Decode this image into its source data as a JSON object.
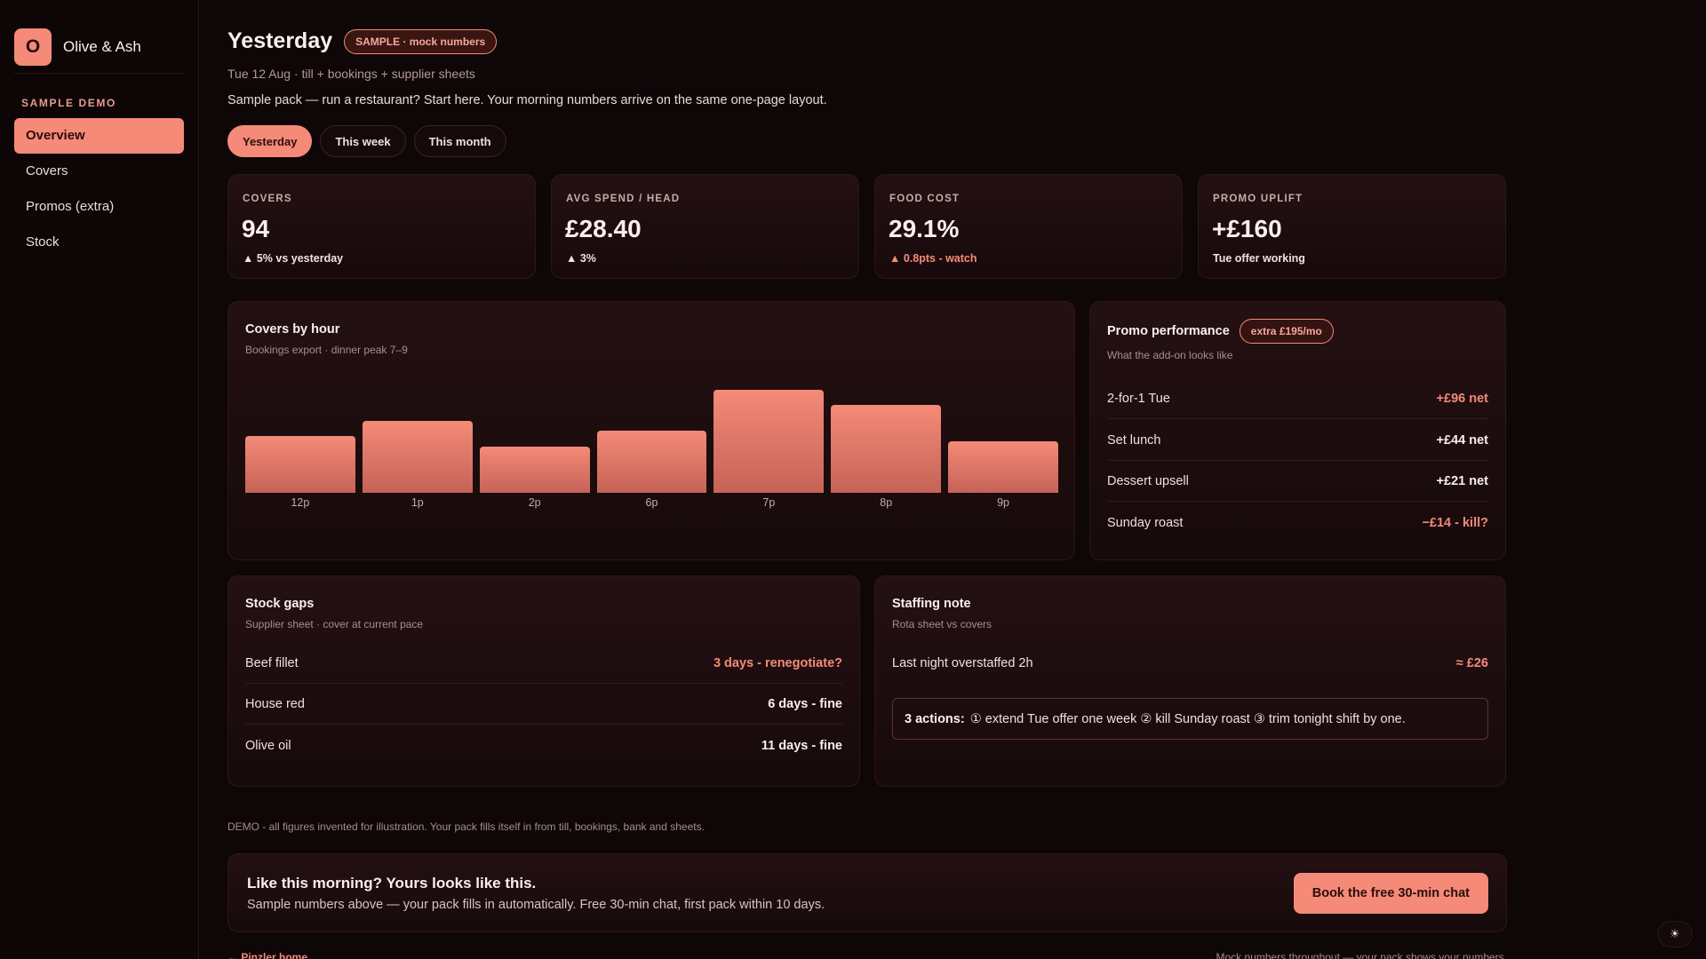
{
  "brand": {
    "logo_letter": "O",
    "name": "Olive & Ash"
  },
  "sidebar": {
    "section": "SAMPLE DEMO",
    "items": [
      {
        "label": "Overview",
        "active": true
      },
      {
        "label": "Covers"
      },
      {
        "label": "Promos (extra)"
      },
      {
        "label": "Stock"
      }
    ]
  },
  "header": {
    "title": "Yesterday",
    "badge": "SAMPLE · mock numbers",
    "subtitle": "Tue 12 Aug · till + bookings + supplier sheets",
    "intro": "Sample pack — run a restaurant? Start here. Your morning numbers arrive on the same one-page layout."
  },
  "tabs": [
    {
      "label": "Yesterday",
      "active": true
    },
    {
      "label": "This week"
    },
    {
      "label": "This month"
    }
  ],
  "kpis": [
    {
      "label": "COVERS",
      "value": "94",
      "delta": "▲ 5% vs yesterday"
    },
    {
      "label": "AVG SPEND / HEAD",
      "value": "£28.40",
      "delta": "▲ 3%"
    },
    {
      "label": "FOOD COST",
      "value": "29.1%",
      "delta": "▲ 0.8pts - watch"
    },
    {
      "label": "PROMO UPLIFT",
      "value": "+£160",
      "delta": "Tue offer working"
    }
  ],
  "covers_chart": {
    "title": "Covers by hour",
    "subtitle": "Bookings export · dinner peak 7–9"
  },
  "chart_data": {
    "type": "bar",
    "categories": [
      "12p",
      "1p",
      "2p",
      "6p",
      "7p",
      "8p",
      "9p"
    ],
    "values": [
      11,
      14,
      9,
      12,
      20,
      17,
      10
    ],
    "ylim": [
      0,
      20
    ],
    "grid": false,
    "color": "#f58a78"
  },
  "promo": {
    "title": "Promo performance",
    "badge": "extra £195/mo",
    "subtitle": "What the add-on looks like",
    "rows": [
      {
        "label": "2-for-1 Tue",
        "value": "+£96 net",
        "accent": true
      },
      {
        "label": "Set lunch",
        "value": "+£44 net",
        "accent": false
      },
      {
        "label": "Dessert upsell",
        "value": "+£21 net",
        "accent": false
      },
      {
        "label": "Sunday roast",
        "value": "−£14 - kill?",
        "accent": true
      }
    ]
  },
  "stock": {
    "title": "Stock gaps",
    "subtitle": "Supplier sheet · cover at current pace",
    "rows": [
      {
        "label": "Beef fillet",
        "value": "3 days - renegotiate?",
        "accent": true
      },
      {
        "label": "House red",
        "value": "6 days - fine",
        "accent": false
      },
      {
        "label": "Olive oil",
        "value": "11 days - fine",
        "accent": false
      }
    ]
  },
  "staffing": {
    "title": "Staffing note",
    "subtitle": "Rota sheet vs covers",
    "row_label": "Last night overstaffed 2h",
    "row_value": "≈ £26",
    "actions_label": "3 actions:",
    "actions_text": "① extend Tue offer one week ② kill Sunday roast ③ trim tonight shift by one."
  },
  "demo_note": "DEMO - all figures invented for illustration. Your pack fills itself in from till, bookings, bank and sheets.",
  "cta": {
    "title": "Like this morning? Yours looks like this.",
    "subtitle": "Sample numbers above — your pack fills in automatically. Free 30-min chat, first pack within 10 days.",
    "button": "Book the free 30-min chat"
  },
  "footer": {
    "left": "← Pinzler home",
    "right": "Mock numbers throughout — your pack shows your numbers."
  },
  "theme_toggle": "☀"
}
